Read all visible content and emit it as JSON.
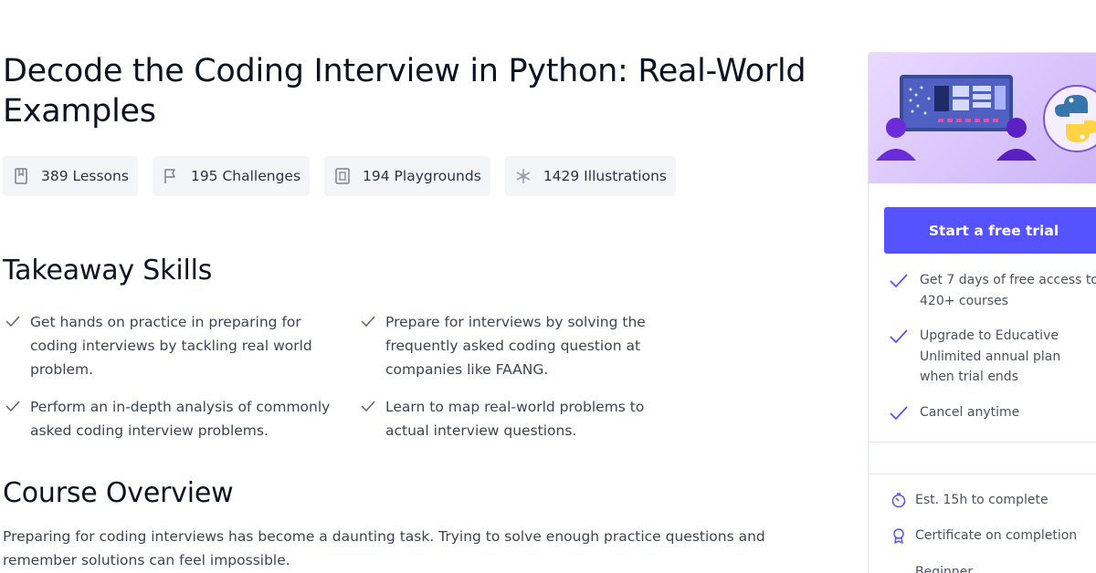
{
  "course": {
    "title": "Decode the Coding Interview in Python: Real-World Examples"
  },
  "stats": [
    {
      "icon": "lessons-book-icon",
      "label": "389 Lessons"
    },
    {
      "icon": "challenges-flag-icon",
      "label": "195 Challenges"
    },
    {
      "icon": "playgrounds-code-icon",
      "label": "194 Playgrounds"
    },
    {
      "icon": "illustrations-snowflake-icon",
      "label": "1429 Illustrations"
    }
  ],
  "takeaway": {
    "heading": "Takeaway Skills",
    "items": [
      "Get hands on practice in preparing for coding interviews by tackling real world problem.",
      "Prepare for interviews by solving the frequently asked coding question at companies like FAANG.",
      "Perform an in-depth analysis of commonly asked coding interview problems.",
      "Learn to map real-world problems to actual interview questions."
    ]
  },
  "overview": {
    "heading": "Course Overview",
    "text": "Preparing for coding interviews has become a daunting task. Trying to solve enough practice questions and remember solutions can feel impossible."
  },
  "sidebar": {
    "cta_label": "Start a free trial",
    "perks": [
      "Get 7 days of free access to 420+ courses",
      "Upgrade to Educative Unlimited annual plan when trial ends",
      "Cancel anytime"
    ],
    "meta": [
      {
        "icon": "timer-icon",
        "label": "Est. 15h to complete"
      },
      {
        "icon": "certificate-icon",
        "label": "Certificate on completion"
      },
      {
        "icon": "level-bars-icon",
        "label": "Beginner"
      }
    ]
  },
  "colors": {
    "accent": "#5553ff",
    "check": "#5553ff",
    "hero_bg": "#d7c2fb"
  }
}
